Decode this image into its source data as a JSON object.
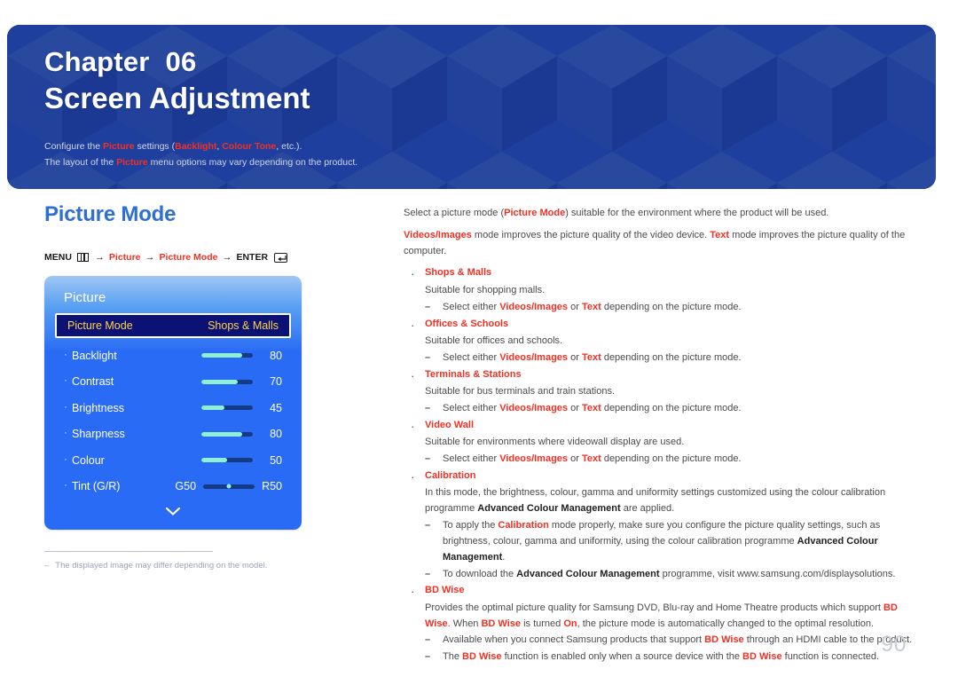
{
  "banner": {
    "chapter_label": "Chapter",
    "chapter_number": "06",
    "title": "Screen Adjustment",
    "desc_line1_pre": "Configure the ",
    "desc_line1_hl1": "Picture",
    "desc_line1_mid": " settings (",
    "desc_line1_hl2": "Backlight",
    "desc_line1_sep": ", ",
    "desc_line1_hl3": "Colour Tone",
    "desc_line1_post": ", etc.).",
    "desc_line2_pre": "The layout of the ",
    "desc_line2_hl": "Picture",
    "desc_line2_post": " menu options may vary depending on the product.",
    "accent_blue": "#1f3f9e",
    "accent_red": "#ef3124"
  },
  "section": {
    "heading": "Picture Mode",
    "heading_color": "#2e6fd4"
  },
  "menu_path": {
    "menu_label": "MENU",
    "menu_icon": "menu-bars-icon",
    "arrow": "→",
    "step1": "Picture",
    "step2": "Picture Mode",
    "enter_label": "ENTER",
    "enter_icon": "enter-key-icon"
  },
  "osd": {
    "title": "Picture",
    "selected_row": {
      "name": "Picture Mode",
      "value": "Shops & Malls",
      "text_color": "#ffd34d",
      "bg_color": "#0b1273"
    },
    "rows": [
      {
        "name": "Backlight",
        "value": "80",
        "percent": 80,
        "type": "slider"
      },
      {
        "name": "Contrast",
        "value": "70",
        "percent": 70,
        "type": "slider"
      },
      {
        "name": "Brightness",
        "value": "45",
        "percent": 45,
        "type": "slider"
      },
      {
        "name": "Sharpness",
        "value": "80",
        "percent": 80,
        "type": "slider"
      },
      {
        "name": "Colour",
        "value": "50",
        "percent": 50,
        "type": "slider"
      }
    ],
    "tint_row": {
      "name": "Tint (G/R)",
      "left_label": "G50",
      "right_label": "R50",
      "type": "centered-slider"
    },
    "scroll_indicator": "chevron-down-icon",
    "fill_color": "#8ff0d8",
    "track_color": "#153a86"
  },
  "footnote": {
    "dash": "–",
    "text": "The displayed image may differ depending on the model."
  },
  "body": {
    "p1_a": "Select a picture mode (",
    "p1_b": "Picture Mode",
    "p1_c": ") suitable for the environment where the product will be used.",
    "p2_a": "Videos/Images",
    "p2_b": " mode improves the picture quality of the video device. ",
    "p2_c": "Text",
    "p2_d": " mode improves the picture quality of the computer.",
    "bullet_marker": "·",
    "sub_marker": "–",
    "items": [
      {
        "title": "Shops & Malls",
        "desc": "Suitable for shopping malls.",
        "subs": [
          {
            "a": "Select either ",
            "r1": "Videos/Images",
            "b": " or ",
            "r2": "Text",
            "c": " depending on the picture mode."
          }
        ]
      },
      {
        "title": "Offices & Schools",
        "desc": "Suitable for offices and schools.",
        "subs": [
          {
            "a": "Select either ",
            "r1": "Videos/Images",
            "b": " or ",
            "r2": "Text",
            "c": " depending on the picture mode."
          }
        ]
      },
      {
        "title": "Terminals & Stations",
        "desc": "Suitable for bus terminals and train stations.",
        "subs": [
          {
            "a": "Select either ",
            "r1": "Videos/Images",
            "b": " or ",
            "r2": "Text",
            "c": " depending on the picture mode."
          }
        ]
      },
      {
        "title": "Video Wall",
        "desc": "Suitable for environments where videowall display are used.",
        "subs": [
          {
            "a": "Select either ",
            "r1": "Videos/Images",
            "b": " or ",
            "r2": "Text",
            "c": " depending on the picture mode."
          }
        ]
      }
    ],
    "calibration": {
      "title": "Calibration",
      "desc_a": "In this mode, the brightness, colour, gamma and uniformity settings customized using the colour calibration programme ",
      "desc_b": "Advanced Colour Management",
      "desc_c": " are applied.",
      "sub1_a": "To apply the ",
      "sub1_r": "Calibration",
      "sub1_b": " mode properly, make sure you configure the picture quality settings, such as brightness, colour, gamma and uniformity, using the colour calibration programme ",
      "sub1_bold": "Advanced Colour Management",
      "sub1_c": ".",
      "sub2_a": "To download the ",
      "sub2_bold": "Advanced Colour Management",
      "sub2_b": " programme, visit www.samsung.com/displaysolutions."
    },
    "bdwise": {
      "title": "BD Wise",
      "desc_a": "Provides the optimal picture quality for Samsung DVD, Blu-ray and Home Theatre products which support ",
      "desc_r1": "BD Wise",
      "desc_b": ". When ",
      "desc_r2": "BD Wise",
      "desc_c": " is turned ",
      "desc_r3": "On",
      "desc_d": ", the picture mode is automatically changed to the optimal resolution.",
      "sub1_a": "Available when you connect Samsung products that support ",
      "sub1_r": "BD Wise",
      "sub1_b": " through an HDMI cable to the product.",
      "sub2_a": "The ",
      "sub2_r1": "BD Wise",
      "sub2_b": " function is enabled only when a source device with the ",
      "sub2_r2": "BD Wise",
      "sub2_c": " function is connected."
    }
  },
  "page_number": "90"
}
